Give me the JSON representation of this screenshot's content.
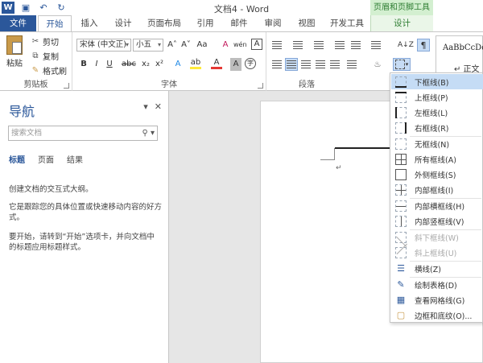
{
  "window": {
    "title": "文档4 - Word",
    "context_tab_group": "页眉和页脚工具"
  },
  "tabs": [
    {
      "label": "文件"
    },
    {
      "label": "开始"
    },
    {
      "label": "插入"
    },
    {
      "label": "设计"
    },
    {
      "label": "页面布局"
    },
    {
      "label": "引用"
    },
    {
      "label": "邮件"
    },
    {
      "label": "审阅"
    },
    {
      "label": "视图"
    },
    {
      "label": "开发工具"
    },
    {
      "label": "设计"
    }
  ],
  "ribbon": {
    "clipboard": {
      "paste": "粘贴",
      "cut": "剪切",
      "copy": "复制",
      "format_painter": "格式刷",
      "group_label": "剪贴板"
    },
    "font": {
      "font_name": "宋体 (中文正)",
      "font_size": "小五",
      "grow": "A˄",
      "shrink": "A˅",
      "change_case": "Aa",
      "clear_format": "A",
      "phonetic": "wén",
      "border_char": "A",
      "bold": "B",
      "italic": "I",
      "underline": "U",
      "strike": "abc",
      "subscript": "x₂",
      "superscript": "x²",
      "effects": "A",
      "highlight": "ab",
      "font_color": "A",
      "shading": "A",
      "enclose": "字",
      "group_label": "字体"
    },
    "paragraph": {
      "group_label": "段落",
      "sort": "A↓Z",
      "marks": "¶"
    },
    "styles": {
      "sample": "AaBbCcDd",
      "name": "↵ 正文"
    }
  },
  "nav": {
    "title": "导航",
    "search_placeholder": "搜索文档",
    "tabs": [
      "标题",
      "页面",
      "结果"
    ],
    "text1": "创建文档的交互式大纲。",
    "text2": "它是跟踪您的具体位置或快速移动内容的好方式。",
    "text3": "要开始，请转到“开始”选项卡，并向文档中的标题应用标题样式。"
  },
  "document": {
    "paragraph_mark": "↵"
  },
  "border_menu": [
    {
      "label": "下框线(B)",
      "icon": "bottom-border-icon",
      "highlighted": true
    },
    {
      "label": "上框线(P)",
      "icon": "top-border-icon"
    },
    {
      "label": "左框线(L)",
      "icon": "left-border-icon"
    },
    {
      "label": "右框线(R)",
      "icon": "right-border-icon"
    },
    {
      "label": "无框线(N)",
      "icon": "no-border-icon"
    },
    {
      "label": "所有框线(A)",
      "icon": "all-borders-icon"
    },
    {
      "label": "外侧框线(S)",
      "icon": "outside-borders-icon"
    },
    {
      "label": "内部框线(I)",
      "icon": "inside-borders-icon"
    },
    {
      "label": "内部横框线(H)",
      "icon": "inside-horizontal-border-icon"
    },
    {
      "label": "内部竖框线(V)",
      "icon": "inside-vertical-border-icon"
    },
    {
      "label": "斜下框线(W)",
      "icon": "diagonal-down-border-icon",
      "disabled": true
    },
    {
      "label": "斜上框线(U)",
      "icon": "diagonal-up-border-icon",
      "disabled": true
    },
    {
      "label": "横线(Z)",
      "icon": "horizontal-line-icon"
    },
    {
      "label": "绘制表格(D)",
      "icon": "draw-table-icon"
    },
    {
      "label": "查看网格线(G)",
      "icon": "view-gridlines-icon"
    },
    {
      "label": "边框和底纹(O)...",
      "icon": "borders-shading-icon"
    }
  ],
  "colors": {
    "brand": "#2b579a",
    "context": "#2e7d32",
    "menu_highlight": "#c5dcf5"
  }
}
